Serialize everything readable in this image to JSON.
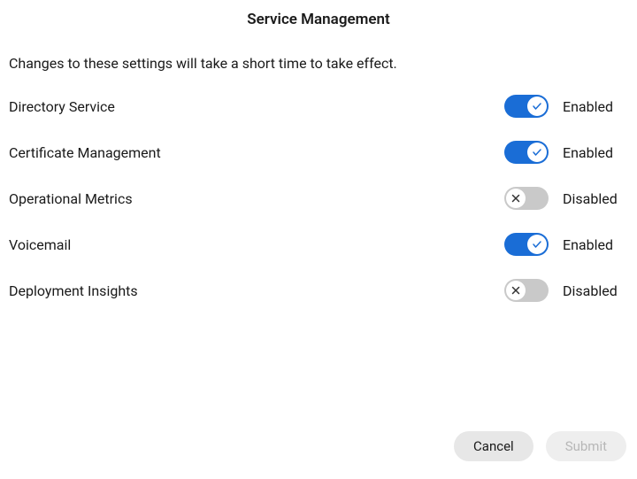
{
  "title": "Service Management",
  "subtitle": "Changes to these settings will take a short time to take effect.",
  "status_labels": {
    "enabled": "Enabled",
    "disabled": "Disabled"
  },
  "colors": {
    "toggle_on": "#1a6dd6",
    "toggle_off": "#c9c9c9"
  },
  "services": [
    {
      "label": "Directory Service",
      "enabled": true
    },
    {
      "label": "Certificate Management",
      "enabled": true
    },
    {
      "label": "Operational Metrics",
      "enabled": false
    },
    {
      "label": "Voicemail",
      "enabled": true
    },
    {
      "label": "Deployment Insights",
      "enabled": false
    }
  ],
  "footer": {
    "cancel_label": "Cancel",
    "submit_label": "Submit",
    "submit_disabled": true
  }
}
